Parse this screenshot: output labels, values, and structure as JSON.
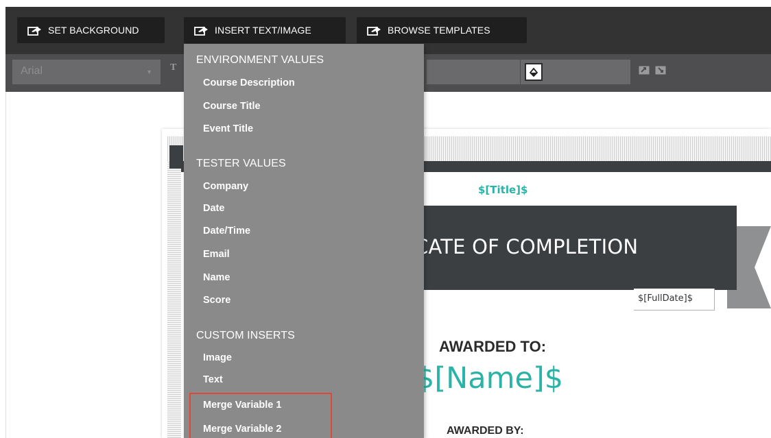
{
  "toolbar": {
    "set_background": "SET BACKGROUND",
    "insert_text_image": "INSERT TEXT/IMAGE",
    "browse_templates": "BROWSE TEMPLATES",
    "icon": "export-arrow-icon"
  },
  "format_bar": {
    "font_value": "Arial",
    "size_label": "T"
  },
  "menu": {
    "sections": [
      {
        "header": "ENVIRONMENT VALUES",
        "items": [
          "Course Description",
          "Course Title",
          "Event Title"
        ]
      },
      {
        "header": "TESTER VALUES",
        "items": [
          "Company",
          "Date",
          "Date/Time",
          "Email",
          "Name",
          "Score"
        ]
      },
      {
        "header": "CUSTOM INSERTS",
        "items": [
          "Image",
          "Text",
          "Merge Variable 1",
          "Merge Variable 2"
        ]
      }
    ]
  },
  "certificate": {
    "title_var": "$[Title]$",
    "heading": "CATE OF COMPLETION",
    "fulldate_var": "$[FullDate]$",
    "awarded_to": "AWARDED TO:",
    "name_var": "$[Name]$",
    "awarded_by": "AWARDED BY:"
  },
  "colors": {
    "accent_teal": "#2ab3a6",
    "toolbar_dark": "#333334",
    "menu_gray": "#8a8a8a",
    "highlight_red": "#e0453a",
    "ribbon_dark": "#3c3f42"
  }
}
